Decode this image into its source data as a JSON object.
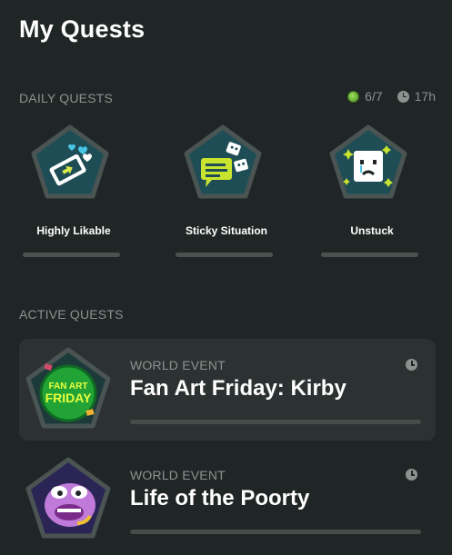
{
  "header": {
    "title": "My Quests"
  },
  "daily": {
    "label": "DAILY QUESTS",
    "progress": "6/7",
    "time_left": "17h",
    "quests": [
      {
        "name": "Highly Likable",
        "icon": "phone-hearts-icon",
        "progress": 0
      },
      {
        "name": "Sticky Situation",
        "icon": "sticky-note-icon",
        "progress": 0
      },
      {
        "name": "Unstuck",
        "icon": "sad-sticky-face-icon",
        "progress": 0
      }
    ]
  },
  "active": {
    "label": "ACTIVE QUESTS",
    "quests": [
      {
        "event_label": "WORLD EVENT",
        "name": "Fan Art Friday: Kirby",
        "badge_text_1": "FAN ART",
        "badge_text_2": "FRIDAY",
        "progress": 0
      },
      {
        "event_label": "WORLD EVENT",
        "name": "Life of the Poorty",
        "progress": 0
      }
    ]
  },
  "colors": {
    "background": "#202625",
    "card": "#2b3231",
    "muted_text": "#8b9391",
    "badge_fill": "#1f4d55",
    "badge_border": "#4a5452",
    "accent_green": "#7ed321"
  }
}
